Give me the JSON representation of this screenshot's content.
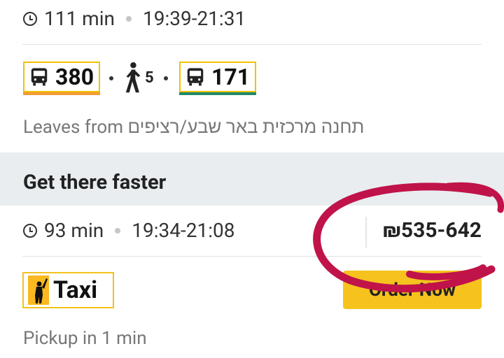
{
  "route1": {
    "duration": "111 min",
    "time_range": "19:39-21:31",
    "segments": [
      {
        "type": "bus",
        "line": "380",
        "color": "#f39a35"
      },
      {
        "type": "walk",
        "minutes": "5"
      },
      {
        "type": "bus",
        "line": "171",
        "color": "#1f8a6a"
      }
    ],
    "leaves_from": "Leaves from תחנה מרכזית באר שבע/רציפים"
  },
  "faster_banner": "Get there faster",
  "route2": {
    "duration": "93 min",
    "time_range": "19:34-21:08",
    "price": "₪535-642"
  },
  "taxi": {
    "label": "Taxi",
    "order_button": "Order Now",
    "pickup": "Pickup in 1 min"
  },
  "colors": {
    "accent_yellow": "#f6c21d",
    "annotation": "#c0134a"
  }
}
